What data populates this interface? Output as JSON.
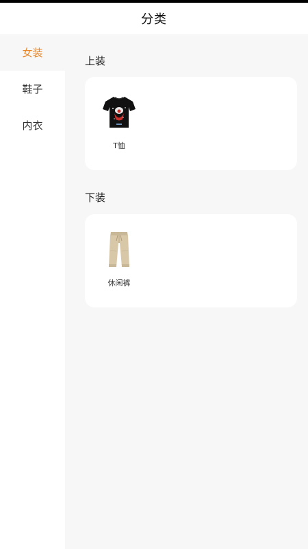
{
  "header": {
    "title": "分类"
  },
  "sidebar": {
    "items": [
      {
        "label": "女装",
        "active": true
      },
      {
        "label": "鞋子",
        "active": false
      },
      {
        "label": "内衣",
        "active": false
      }
    ]
  },
  "sections": [
    {
      "title": "上装",
      "products": [
        {
          "name": "T恤",
          "icon": "black-tshirt-icon"
        }
      ]
    },
    {
      "title": "下装",
      "products": [
        {
          "name": "休闲裤",
          "icon": "beige-pants-icon"
        }
      ]
    }
  ],
  "colors": {
    "accent": "#e8862a",
    "content_bg": "#f7f7f7",
    "card_bg": "#ffffff",
    "text": "#222222"
  }
}
